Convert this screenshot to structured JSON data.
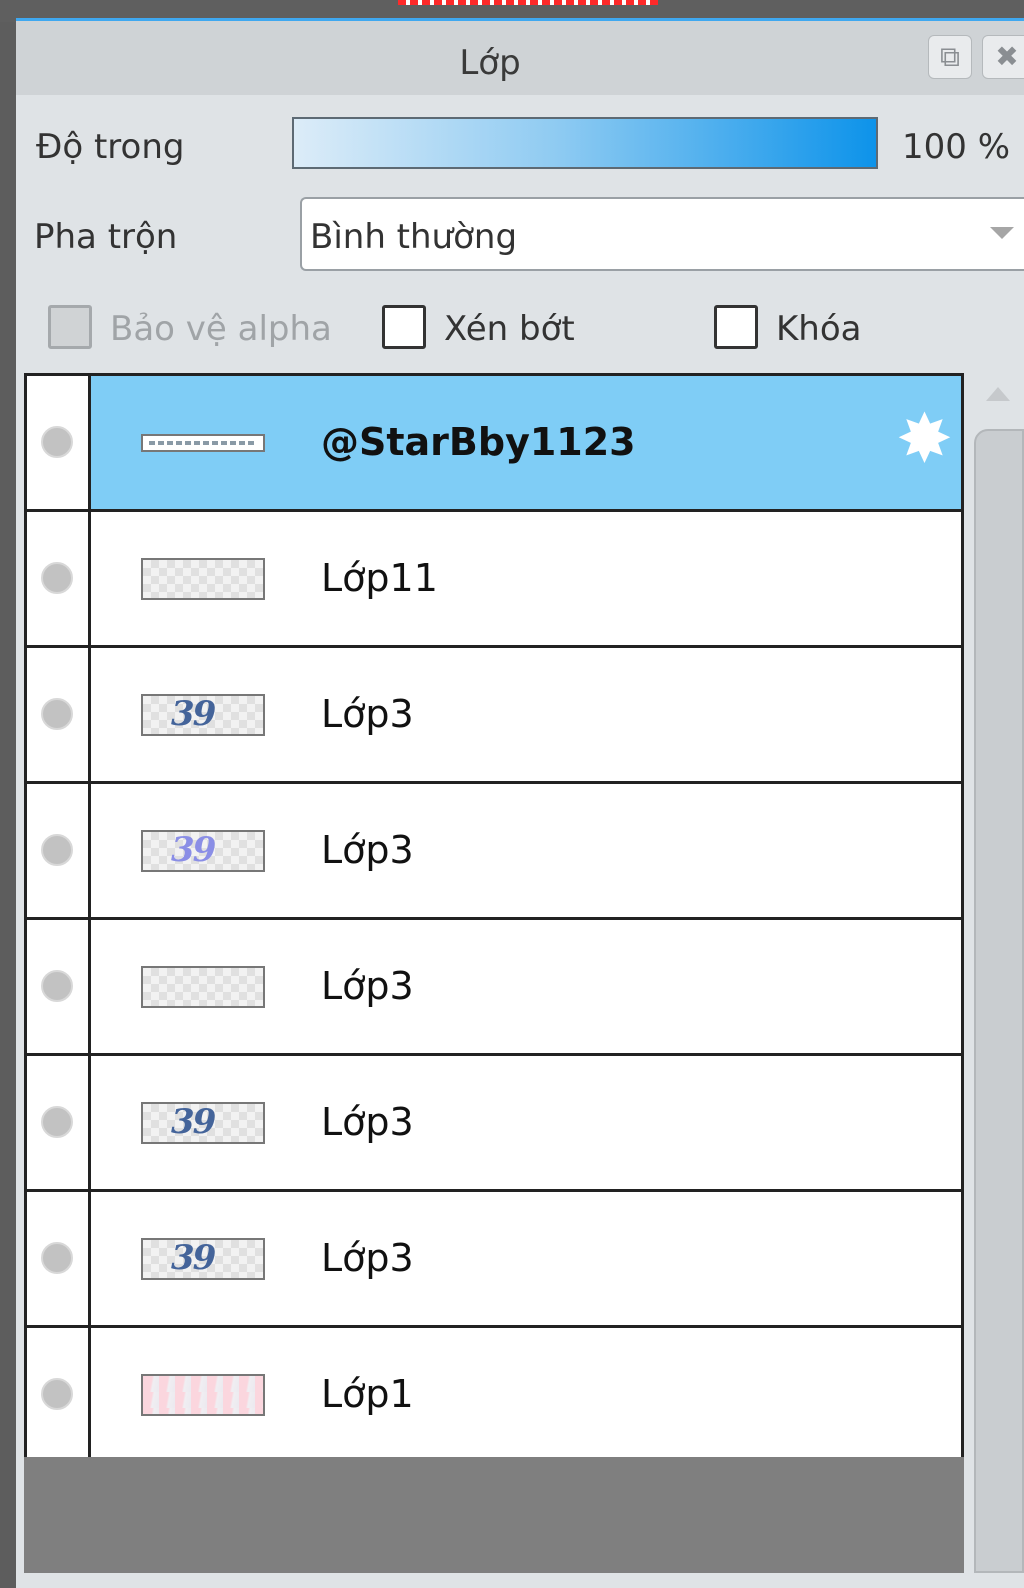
{
  "panel": {
    "title": "Lớp"
  },
  "opacity": {
    "label": "Độ trong",
    "value": "100 %",
    "level_percent": 100
  },
  "blend": {
    "label": "Pha trộn",
    "value": "Bình thường"
  },
  "options": [
    {
      "label": "Bảo vệ alpha",
      "checked": false,
      "disabled": true
    },
    {
      "label": "Xén bớt",
      "checked": false,
      "disabled": false
    },
    {
      "label": "Khóa",
      "checked": false,
      "disabled": false
    }
  ],
  "layers": [
    {
      "name": "@StarBby1123",
      "selected": true,
      "thumb": "strip"
    },
    {
      "name": "Lớp11",
      "selected": false,
      "thumb": "checker"
    },
    {
      "name": "Lớp3",
      "selected": false,
      "thumb": "art"
    },
    {
      "name": "Lớp3",
      "selected": false,
      "thumb": "art-light"
    },
    {
      "name": "Lớp3",
      "selected": false,
      "thumb": "checker"
    },
    {
      "name": "Lớp3",
      "selected": false,
      "thumb": "art"
    },
    {
      "name": "Lớp3",
      "selected": false,
      "thumb": "art"
    },
    {
      "name": "Lớp1",
      "selected": false,
      "thumb": "pink"
    }
  ],
  "colors": {
    "accent": "#3fa8f0",
    "selected_row": "#7fcdf6",
    "opacity_bar_end": "#0d93ea"
  },
  "icons": {
    "popout": "popout-icon",
    "close": "close-icon",
    "settings": "gear-icon",
    "visibility": "visibility-dot-icon",
    "dropdown": "chevron-down-icon"
  }
}
